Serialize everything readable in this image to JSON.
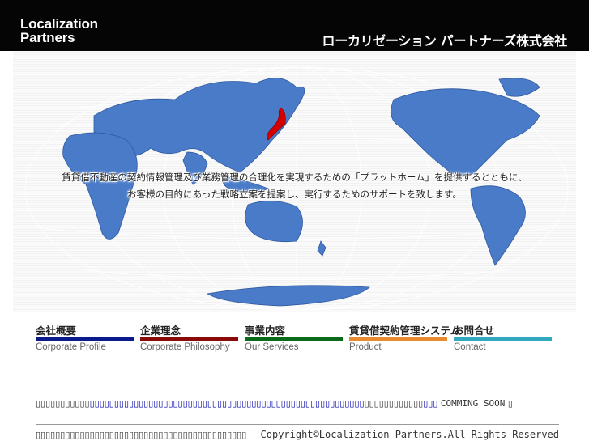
{
  "header": {
    "logo_line1": "Localization",
    "logo_line2": "Partners",
    "company_name": "ローカリゼーション パートナーズ株式会社",
    "background": "#050505"
  },
  "hero": {
    "tagline_line1": "賃貸借不動産の契約情報管理及び業務管理の合理化を実現するための「プラットホーム」を提供するとともに、",
    "tagline_line2": "お客様の目的にあった戦略立案を提案し、実行するためのサポートを致します。",
    "land_color": "#4a7bc8",
    "japan_color": "#d40000"
  },
  "nav": {
    "items": [
      {
        "label_jp": "会社概要",
        "label_en": "Corporate Profile",
        "color": "#0a1a8a"
      },
      {
        "label_jp": "企業理念",
        "label_en": "Corporate Philosophy",
        "color": "#8a0a0a"
      },
      {
        "label_jp": "事業内容",
        "label_en": "Our Services",
        "color": "#0a6a1a"
      },
      {
        "label_jp": "賃貸借契約管理システム",
        "label_en": "Product",
        "color": "#e88a30"
      },
      {
        "label_jp": "お問合せ",
        "label_en": "Contact",
        "color": "#30a8c0"
      }
    ]
  },
  "notice": {
    "prefix": "▯▯▯▯▯▯▯▯▯▯▯",
    "link": "▯▯▯▯▯▯▯▯▯▯▯▯▯▯▯▯▯▯▯▯▯▯▯▯▯▯▯▯▯▯▯▯▯▯▯▯▯▯▯▯▯▯▯▯▯▯▯▯▯▯▯▯▯▯▯▯",
    "middle": "▯▯▯▯▯▯▯▯▯▯▯▯",
    "blue2": "▯▯▯",
    "status": "COMMING SOON",
    "suffix": "▯"
  },
  "footer": {
    "left_text": "▯▯▯▯▯▯▯▯▯▯▯▯▯▯▯▯▯▯▯▯▯▯▯▯▯▯▯▯▯▯▯▯▯▯▯▯▯▯▯▯▯▯▯",
    "copyright": "Copyright©Localization Partners.All Rights Reserved"
  }
}
